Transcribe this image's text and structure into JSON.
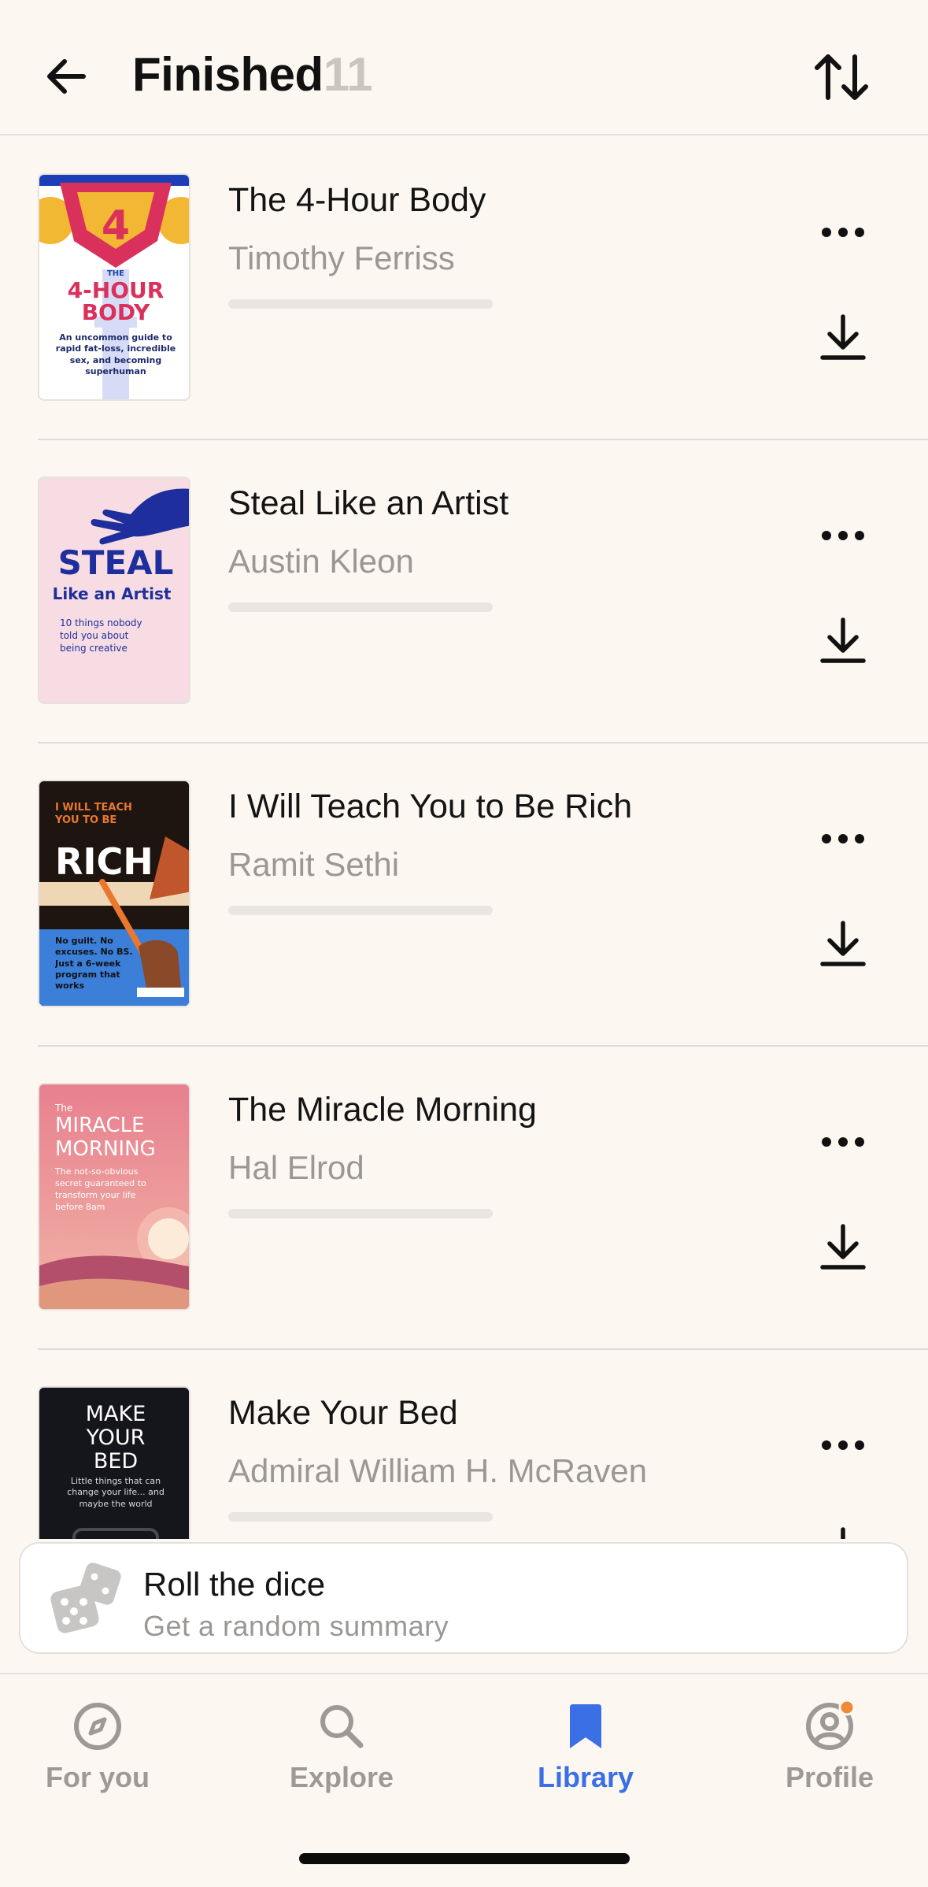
{
  "header": {
    "title": "Finished",
    "count": "11",
    "back_icon": "arrow-left-icon",
    "sort_icon": "sort-arrows-icon"
  },
  "books": [
    {
      "title": "The 4-Hour Body",
      "author": "Timothy Ferriss",
      "progress": 0,
      "cover": {
        "kicker": "THE",
        "title_line1": "4-HOUR",
        "title_line2": "BODY",
        "tagline": "An uncommon guide to rapid fat-loss, incredible sex, and becoming superhuman"
      }
    },
    {
      "title": "Steal Like an Artist",
      "author": "Austin Kleon",
      "progress": 0,
      "cover": {
        "title_big": "STEAL",
        "subtitle": "Like an Artist",
        "tagline": "10 things nobody told you about being creative"
      }
    },
    {
      "title": "I Will Teach You to Be Rich",
      "author": "Ramit Sethi",
      "progress": 0,
      "cover": {
        "kicker": "I WILL TEACH YOU TO BE",
        "title_big": "RICH",
        "tagline": "No guilt. No excuses. No BS. Just a 6-week program that works"
      }
    },
    {
      "title": "The Miracle Morning",
      "author": "Hal Elrod",
      "progress": 0,
      "cover": {
        "kicker": "The",
        "title_line1": "MIRACLE",
        "title_line2": "MORNING",
        "tagline": "The not-so-obvious secret guaranteed to transform your life before 8am"
      }
    },
    {
      "title": "Make Your Bed",
      "author": "Admiral William H. McRaven",
      "progress": 0,
      "cover": {
        "title_line1": "MAKE",
        "title_line2": "YOUR",
        "title_line3": "BED",
        "tagline": "Little things that can change your life... and maybe the world"
      }
    }
  ],
  "dice_card": {
    "title": "Roll the dice",
    "subtitle": "Get a random summary",
    "icon": "dice-icon"
  },
  "tabs": [
    {
      "label": "For you",
      "icon": "compass-icon",
      "active": false
    },
    {
      "label": "Explore",
      "icon": "search-icon",
      "active": false
    },
    {
      "label": "Library",
      "icon": "bookmark-icon",
      "active": true
    },
    {
      "label": "Profile",
      "icon": "profile-icon",
      "active": false,
      "badge": true
    }
  ],
  "colors": {
    "background": "#FCF7F1",
    "accent": "#3A6FE6",
    "badge": "#F0883A",
    "muted_text": "#9A9794"
  }
}
